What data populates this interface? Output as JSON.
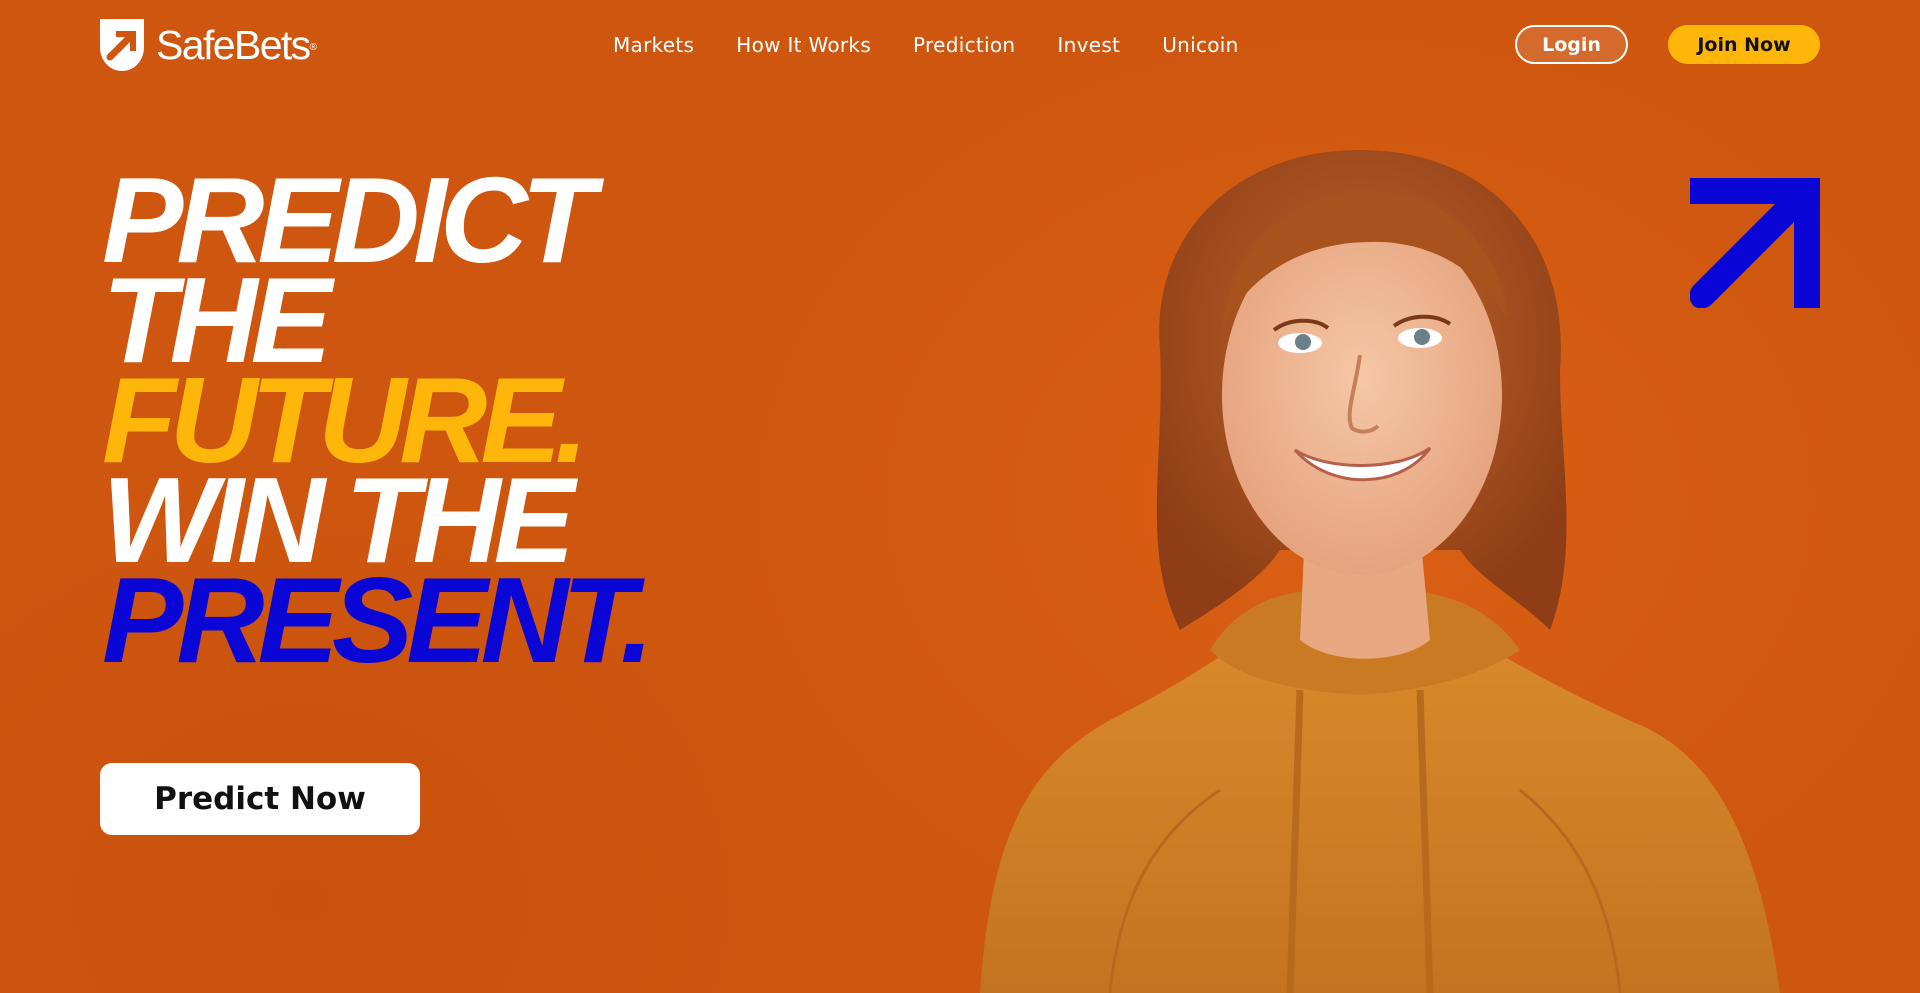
{
  "brand": {
    "name": "SafeBets",
    "registered_mark": "®",
    "logo_icon": "arrow-up-right-shield-icon"
  },
  "nav": {
    "items": [
      "Markets",
      "How It Works",
      "Prediction",
      "Invest",
      "Unicoin"
    ]
  },
  "header_actions": {
    "login_label": "Login",
    "join_label": "Join Now"
  },
  "hero": {
    "headline_lines": [
      "PREDICT",
      "THE",
      "FUTURE.",
      "WIN THE",
      "PRESENT."
    ],
    "cta_label": "Predict Now",
    "arrow_icon": "arrow-up-right-icon",
    "image": "smiling-person-in-hoodie"
  },
  "colors": {
    "background": "#cf560f",
    "accent_yellow": "#ffb60a",
    "accent_blue": "#0a06d6",
    "white": "#ffffff"
  }
}
